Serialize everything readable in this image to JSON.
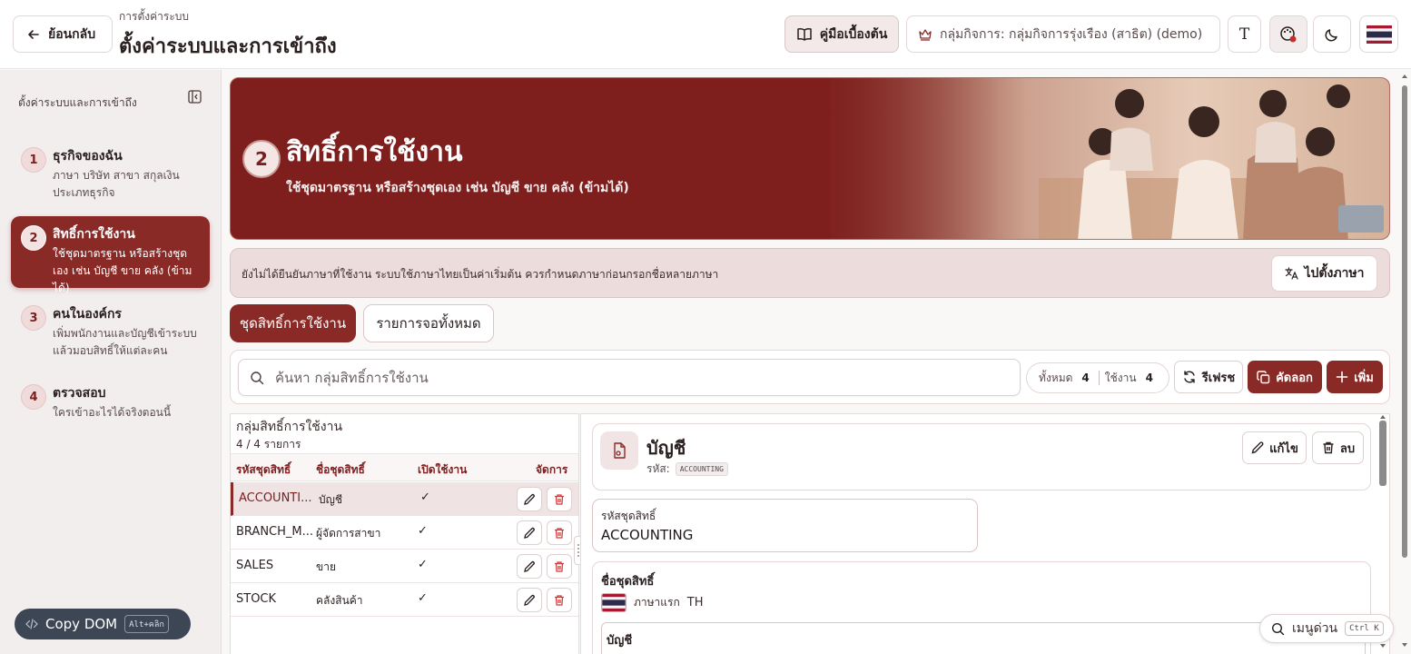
{
  "header": {
    "back_label": "ย้อนกลับ",
    "breadcrumb": "การตั้งค่าระบบ",
    "title": "ตั้งค่าระบบและการเข้าถึง",
    "guide_label": "คู่มือเบื้องต้น",
    "org_label": "กลุ่มกิจการ: กลุ่มกิจการรุ่งเรือง (สาธิต) (demo)",
    "font_button": "T"
  },
  "sidebar": {
    "title": "ตั้งค่าระบบและการเข้าถึง",
    "steps": [
      {
        "num": "1",
        "title": "ธุรกิจของฉัน",
        "desc": "ภาษา บริษัท สาขา สกุลเงิน ประเภทธุรกิจ"
      },
      {
        "num": "2",
        "title": "สิทธิ์การใช้งาน",
        "desc": "ใช้ชุดมาตรฐาน หรือสร้างชุดเอง เช่น บัญชี ขาย คลัง (ข้ามได้)"
      },
      {
        "num": "3",
        "title": "คนในองค์กร",
        "desc": "เพิ่มพนักงานและบัญชีเข้าระบบ แล้วมอบสิทธิ์ให้แต่ละคน"
      },
      {
        "num": "4",
        "title": "ตรวจสอบ",
        "desc": "ใครเข้าอะไรได้จริงตอนนี้"
      }
    ],
    "copy_dom": "Copy DOM",
    "copy_dom_kbd": "Alt+คลิก"
  },
  "hero": {
    "num": "2",
    "title": "สิทธิ์การใช้งาน",
    "subtitle": "ใช้ชุดมาตรฐาน หรือสร้างชุดเอง เช่น บัญชี ขาย คลัง (ข้ามได้)"
  },
  "notice": {
    "text": "ยังไม่ได้ยืนยันภาษาที่ใช้งาน ระบบใช้ภาษาไทยเป็นค่าเริ่มต้น ควรกำหนดภาษาก่อนกรอกชื่อหลายภาษา",
    "button": "ไปตั้งภาษา"
  },
  "tabs": [
    "ชุดสิทธิ์การใช้งาน",
    "รายการจอทั้งหมด"
  ],
  "toolbar": {
    "search_placeholder": "ค้นหา กลุ่มสิทธิ์การใช้งาน",
    "total_label": "ทั้งหมด",
    "total": "4",
    "active_label": "ใช้งาน",
    "active": "4",
    "refresh": "รีเฟรช",
    "copy": "คัดลอก",
    "add": "เพิ่ม"
  },
  "list": {
    "title": "กลุ่มสิทธิ์การใช้งาน",
    "count": "4 / 4 รายการ",
    "columns": [
      "รหัสชุดสิทธิ์",
      "ชื่อชุดสิทธิ์",
      "เปิดใช้งาน",
      "จัดการ"
    ],
    "rows": [
      {
        "code": "ACCOUNTI...",
        "name": "บัญชี",
        "enabled": "✓"
      },
      {
        "code": "BRANCH_M...",
        "name": "ผู้จัดการสาขา",
        "enabled": "✓"
      },
      {
        "code": "SALES",
        "name": "ขาย",
        "enabled": "✓"
      },
      {
        "code": "STOCK",
        "name": "คลังสินค้า",
        "enabled": "✓"
      }
    ]
  },
  "detail": {
    "name": "บัญชี",
    "code_label": "รหัส:",
    "code": "ACCOUNTING",
    "edit": "แก้ไข",
    "delete": "ลบ",
    "field_code_label": "รหัสชุดสิทธิ์",
    "field_code_value": "ACCOUNTING",
    "field_name_label": "ชื่อชุดสิทธิ์",
    "lang_label": "ภาษาแรก",
    "lang_code": "TH",
    "field_name_value": "บัญชี"
  },
  "quick_menu": {
    "label": "เมนูด่วน",
    "kbd": "Ctrl K"
  },
  "colors": {
    "accent": "#8a2a27",
    "hero": "#7e1f1d",
    "danger": "#d23b3b"
  }
}
